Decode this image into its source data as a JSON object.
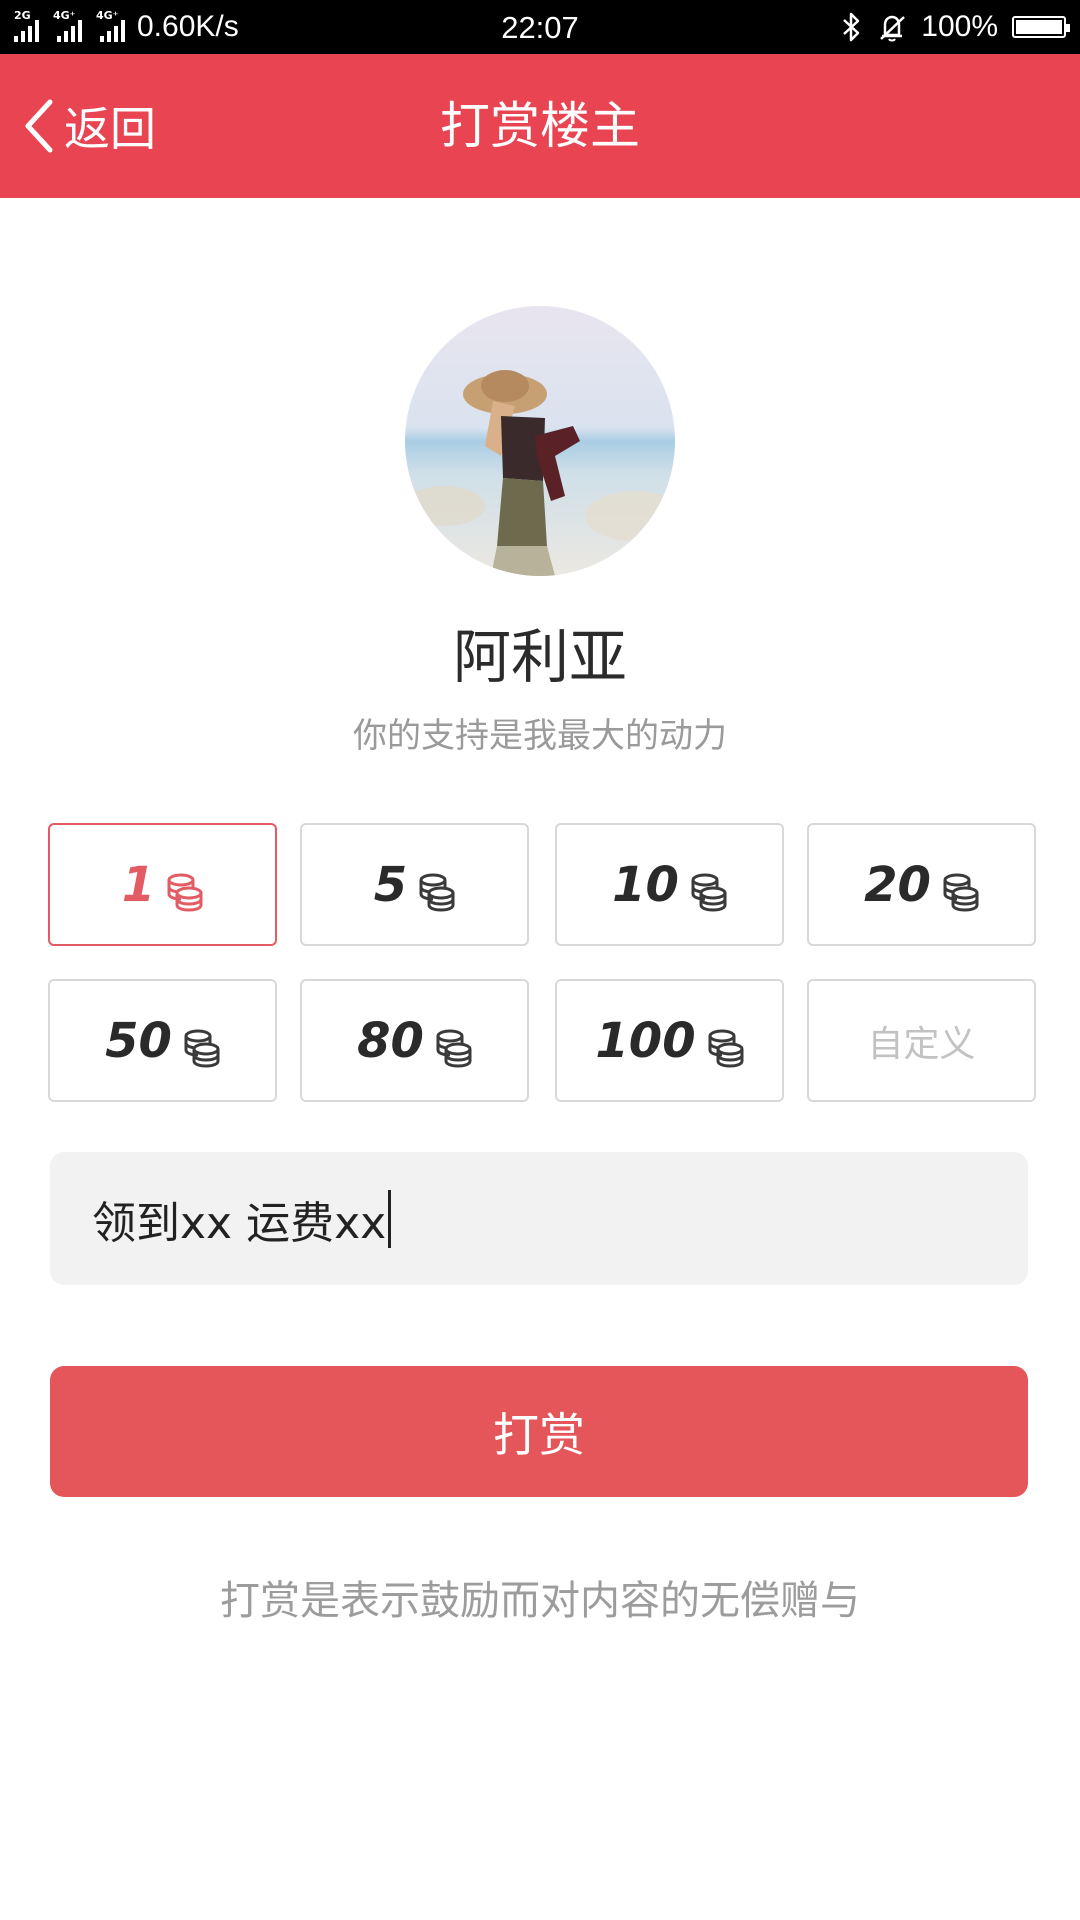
{
  "status_bar": {
    "network_tags": [
      "2G",
      "4G⁺",
      "4G⁺"
    ],
    "speed": "0.60K/s",
    "time": "22:07",
    "battery_percent": "100%",
    "icons": [
      "signal-icon",
      "bluetooth-icon",
      "silent-bell-icon",
      "battery-icon"
    ]
  },
  "nav": {
    "back_label": "返回",
    "title": "打赏楼主",
    "background": "#e84452"
  },
  "profile": {
    "name": "阿利亚",
    "subtitle": "你的支持是我最大的动力"
  },
  "amounts": {
    "options": [
      {
        "value": "1",
        "selected": true
      },
      {
        "value": "5",
        "selected": false
      },
      {
        "value": "10",
        "selected": false
      },
      {
        "value": "20",
        "selected": false
      },
      {
        "value": "50",
        "selected": false
      },
      {
        "value": "80",
        "selected": false
      },
      {
        "value": "100",
        "selected": false
      }
    ],
    "custom_label": "自定义",
    "accent": "#e35b63"
  },
  "message": {
    "value": "领到xx 运费xx"
  },
  "submit": {
    "label": "打赏",
    "background": "#e45659"
  },
  "footer": {
    "note": "打赏是表示鼓励而对内容的无偿赠与"
  }
}
